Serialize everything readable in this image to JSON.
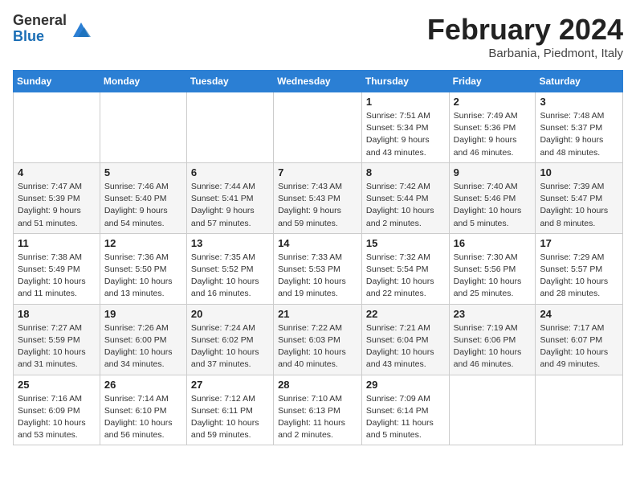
{
  "logo": {
    "general": "General",
    "blue": "Blue"
  },
  "title": "February 2024",
  "location": "Barbania, Piedmont, Italy",
  "days_of_week": [
    "Sunday",
    "Monday",
    "Tuesday",
    "Wednesday",
    "Thursday",
    "Friday",
    "Saturday"
  ],
  "weeks": [
    [
      {
        "day": "",
        "info": ""
      },
      {
        "day": "",
        "info": ""
      },
      {
        "day": "",
        "info": ""
      },
      {
        "day": "",
        "info": ""
      },
      {
        "day": "1",
        "info": "Sunrise: 7:51 AM\nSunset: 5:34 PM\nDaylight: 9 hours\nand 43 minutes."
      },
      {
        "day": "2",
        "info": "Sunrise: 7:49 AM\nSunset: 5:36 PM\nDaylight: 9 hours\nand 46 minutes."
      },
      {
        "day": "3",
        "info": "Sunrise: 7:48 AM\nSunset: 5:37 PM\nDaylight: 9 hours\nand 48 minutes."
      }
    ],
    [
      {
        "day": "4",
        "info": "Sunrise: 7:47 AM\nSunset: 5:39 PM\nDaylight: 9 hours\nand 51 minutes."
      },
      {
        "day": "5",
        "info": "Sunrise: 7:46 AM\nSunset: 5:40 PM\nDaylight: 9 hours\nand 54 minutes."
      },
      {
        "day": "6",
        "info": "Sunrise: 7:44 AM\nSunset: 5:41 PM\nDaylight: 9 hours\nand 57 minutes."
      },
      {
        "day": "7",
        "info": "Sunrise: 7:43 AM\nSunset: 5:43 PM\nDaylight: 9 hours\nand 59 minutes."
      },
      {
        "day": "8",
        "info": "Sunrise: 7:42 AM\nSunset: 5:44 PM\nDaylight: 10 hours\nand 2 minutes."
      },
      {
        "day": "9",
        "info": "Sunrise: 7:40 AM\nSunset: 5:46 PM\nDaylight: 10 hours\nand 5 minutes."
      },
      {
        "day": "10",
        "info": "Sunrise: 7:39 AM\nSunset: 5:47 PM\nDaylight: 10 hours\nand 8 minutes."
      }
    ],
    [
      {
        "day": "11",
        "info": "Sunrise: 7:38 AM\nSunset: 5:49 PM\nDaylight: 10 hours\nand 11 minutes."
      },
      {
        "day": "12",
        "info": "Sunrise: 7:36 AM\nSunset: 5:50 PM\nDaylight: 10 hours\nand 13 minutes."
      },
      {
        "day": "13",
        "info": "Sunrise: 7:35 AM\nSunset: 5:52 PM\nDaylight: 10 hours\nand 16 minutes."
      },
      {
        "day": "14",
        "info": "Sunrise: 7:33 AM\nSunset: 5:53 PM\nDaylight: 10 hours\nand 19 minutes."
      },
      {
        "day": "15",
        "info": "Sunrise: 7:32 AM\nSunset: 5:54 PM\nDaylight: 10 hours\nand 22 minutes."
      },
      {
        "day": "16",
        "info": "Sunrise: 7:30 AM\nSunset: 5:56 PM\nDaylight: 10 hours\nand 25 minutes."
      },
      {
        "day": "17",
        "info": "Sunrise: 7:29 AM\nSunset: 5:57 PM\nDaylight: 10 hours\nand 28 minutes."
      }
    ],
    [
      {
        "day": "18",
        "info": "Sunrise: 7:27 AM\nSunset: 5:59 PM\nDaylight: 10 hours\nand 31 minutes."
      },
      {
        "day": "19",
        "info": "Sunrise: 7:26 AM\nSunset: 6:00 PM\nDaylight: 10 hours\nand 34 minutes."
      },
      {
        "day": "20",
        "info": "Sunrise: 7:24 AM\nSunset: 6:02 PM\nDaylight: 10 hours\nand 37 minutes."
      },
      {
        "day": "21",
        "info": "Sunrise: 7:22 AM\nSunset: 6:03 PM\nDaylight: 10 hours\nand 40 minutes."
      },
      {
        "day": "22",
        "info": "Sunrise: 7:21 AM\nSunset: 6:04 PM\nDaylight: 10 hours\nand 43 minutes."
      },
      {
        "day": "23",
        "info": "Sunrise: 7:19 AM\nSunset: 6:06 PM\nDaylight: 10 hours\nand 46 minutes."
      },
      {
        "day": "24",
        "info": "Sunrise: 7:17 AM\nSunset: 6:07 PM\nDaylight: 10 hours\nand 49 minutes."
      }
    ],
    [
      {
        "day": "25",
        "info": "Sunrise: 7:16 AM\nSunset: 6:09 PM\nDaylight: 10 hours\nand 53 minutes."
      },
      {
        "day": "26",
        "info": "Sunrise: 7:14 AM\nSunset: 6:10 PM\nDaylight: 10 hours\nand 56 minutes."
      },
      {
        "day": "27",
        "info": "Sunrise: 7:12 AM\nSunset: 6:11 PM\nDaylight: 10 hours\nand 59 minutes."
      },
      {
        "day": "28",
        "info": "Sunrise: 7:10 AM\nSunset: 6:13 PM\nDaylight: 11 hours\nand 2 minutes."
      },
      {
        "day": "29",
        "info": "Sunrise: 7:09 AM\nSunset: 6:14 PM\nDaylight: 11 hours\nand 5 minutes."
      },
      {
        "day": "",
        "info": ""
      },
      {
        "day": "",
        "info": ""
      }
    ]
  ]
}
